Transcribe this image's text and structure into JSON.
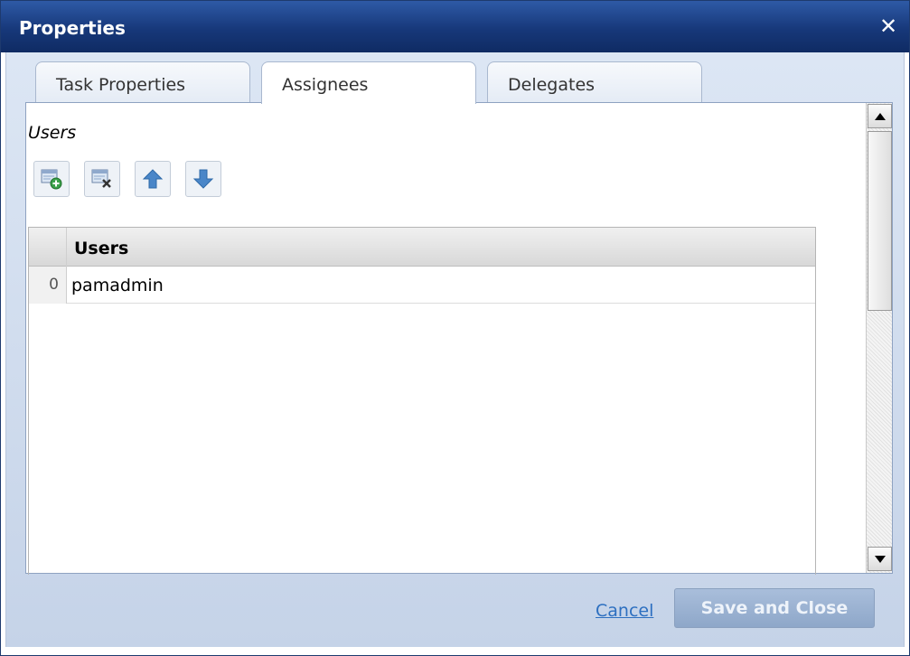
{
  "dialog": {
    "title": "Properties",
    "close_icon": "close-icon"
  },
  "tabs": [
    {
      "label": "Task Properties",
      "active": false
    },
    {
      "label": "Assignees",
      "active": true
    },
    {
      "label": "Delegates",
      "active": false
    }
  ],
  "assignees": {
    "section_label": "Users",
    "toolbar": {
      "add_icon": "add-user-icon",
      "remove_icon": "remove-user-icon",
      "move_up_icon": "arrow-up-icon",
      "move_down_icon": "arrow-down-icon"
    },
    "grid": {
      "column_header": "Users",
      "rows": [
        {
          "index": "0",
          "user": "pamadmin"
        }
      ]
    }
  },
  "footer": {
    "cancel_label": "Cancel",
    "save_label": "Save and Close"
  },
  "colors": {
    "titlebar": "#17387a",
    "frame": "#c5d3e8",
    "link": "#2d6fc0",
    "save_button": "#8ea7c9"
  }
}
